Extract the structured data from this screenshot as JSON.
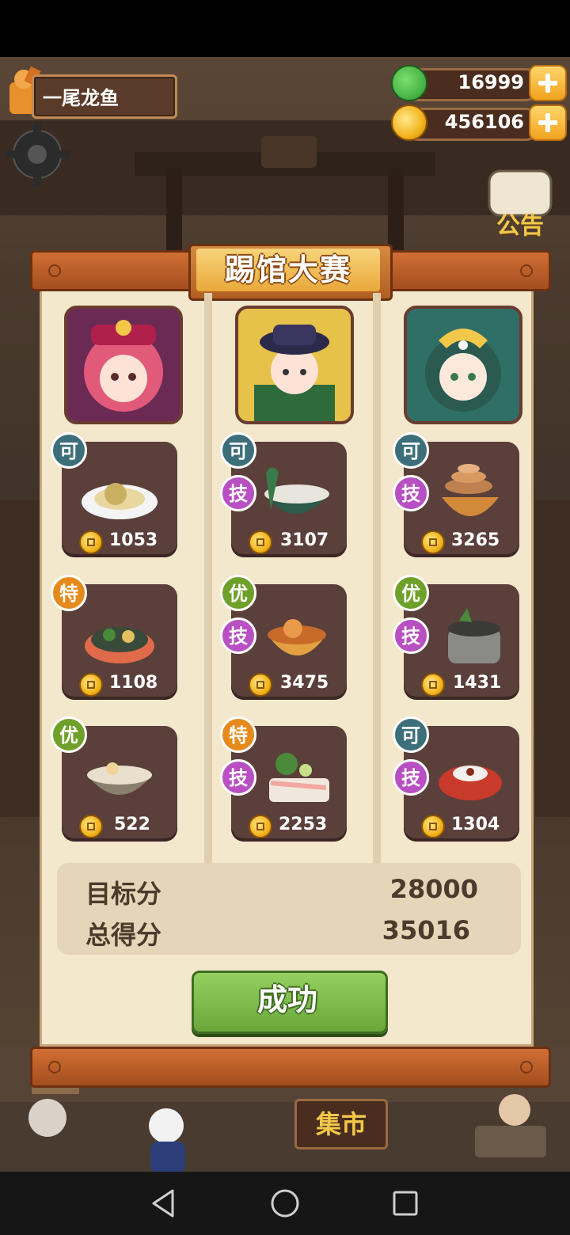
{
  "hud": {
    "player_name": "一尾龙鱼",
    "jade": "16999",
    "coins": "456106",
    "notice_label": "公告"
  },
  "dialog": {
    "title": "踢馆大赛",
    "portraits": [
      "pink-haired-lady",
      "qing-official",
      "green-haired-goddess"
    ],
    "columns": [
      [
        {
          "badge": "可",
          "skill": "",
          "price": "1053"
        },
        {
          "badge": "特",
          "skill": "",
          "price": "1108"
        },
        {
          "badge": "优",
          "skill": "",
          "price": "522"
        }
      ],
      [
        {
          "badge": "可",
          "skill": "技",
          "price": "3107"
        },
        {
          "badge": "优",
          "skill": "技",
          "price": "3475"
        },
        {
          "badge": "特",
          "skill": "技",
          "price": "2253"
        }
      ],
      [
        {
          "badge": "可",
          "skill": "技",
          "price": "3265"
        },
        {
          "badge": "优",
          "skill": "技",
          "price": "1431"
        },
        {
          "badge": "可",
          "skill": "技",
          "price": "1304"
        }
      ]
    ],
    "target_label": "目标分",
    "target_value": "28000",
    "total_label": "总得分",
    "total_value": "35016",
    "button_label": "成功"
  },
  "scene": {
    "market_sign": "集市"
  },
  "colors": {
    "panel": "#f3e7cc",
    "card": "#5a3f3a",
    "badge_ke": "#3d6f7a",
    "badge_you": "#6fa02a",
    "badge_te": "#e58a1b",
    "badge_ji": "#b84fc2",
    "success_green": "#7cbb48"
  }
}
